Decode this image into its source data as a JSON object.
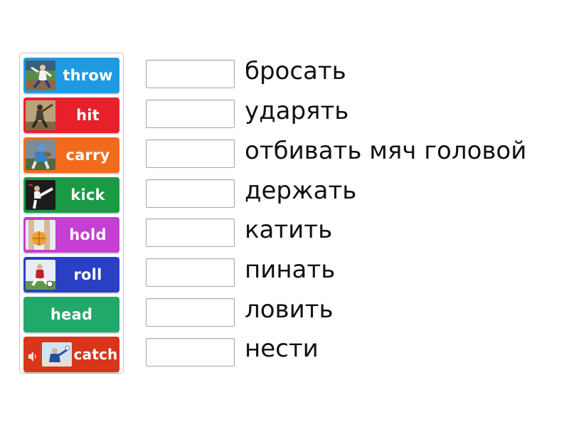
{
  "tiles": [
    {
      "label": "throw",
      "color": "#1e9ae0",
      "image": "pitcher-photo"
    },
    {
      "label": "hit",
      "color": "#e8202b",
      "image": "batter-photo"
    },
    {
      "label": "carry",
      "color": "#f26b1d",
      "image": "carry-player-photo"
    },
    {
      "label": "kick",
      "color": "#1a9a44",
      "image": "karate-kick-photo"
    },
    {
      "label": "hold",
      "color": "#c43fd2",
      "image": "holding-ball-photo"
    },
    {
      "label": "roll",
      "color": "#2940c4",
      "image": "soccer-roll-photo"
    },
    {
      "label": "head",
      "color": "#23a86b",
      "image": ""
    },
    {
      "label": "catch",
      "color": "#d8361b",
      "image": "catch-photo",
      "sound_icon": "speaker-icon"
    }
  ],
  "targets": [
    {
      "text": "бросать"
    },
    {
      "text": "ударять"
    },
    {
      "text": "отбивать мяч головой"
    },
    {
      "text": "держать"
    },
    {
      "text": "катить"
    },
    {
      "text": "пинать"
    },
    {
      "text": "ловить"
    },
    {
      "text": "нести"
    }
  ]
}
